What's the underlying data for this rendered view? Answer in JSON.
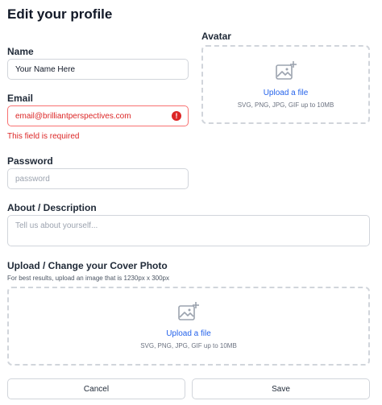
{
  "page": {
    "title": "Edit your profile"
  },
  "name": {
    "label": "Name",
    "value": "Your Name Here"
  },
  "email": {
    "label": "Email",
    "value": "email@brilliantperspectives.com",
    "error": "This field is required",
    "error_icon": "!"
  },
  "password": {
    "label": "Password",
    "placeholder": "password"
  },
  "about": {
    "label": "About / Description",
    "placeholder": "Tell us about yourself..."
  },
  "avatar": {
    "label": "Avatar",
    "upload_link": "Upload a file",
    "hint": "SVG, PNG, JPG, GIF up to 10MB"
  },
  "cover": {
    "label": "Upload / Change your Cover Photo",
    "hint": "For best results, upload an image that is 1230px x 300px",
    "upload_link": "Upload a file",
    "file_hint": "SVG, PNG, JPG, GIF up to 10MB"
  },
  "actions": {
    "cancel": "Cancel",
    "save": "Save"
  },
  "colors": {
    "accent": "#2563eb",
    "error": "#dc2626",
    "border": "#d1d5db"
  }
}
